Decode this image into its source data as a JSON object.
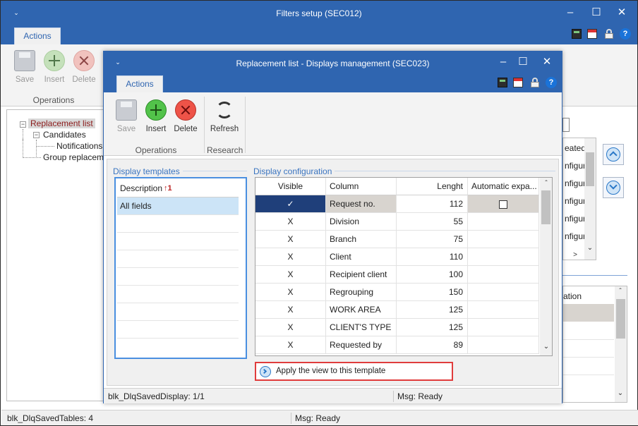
{
  "outer": {
    "title": "Filters setup (SEC012)",
    "tab": "Actions",
    "buttons": {
      "save": "Save",
      "insert": "Insert",
      "delete": "Delete"
    },
    "group_operations": "Operations",
    "tree": {
      "root": "Replacement list",
      "child1": "Candidates",
      "grandchild1": "Notifications",
      "child2": "Group replacemen"
    },
    "right_list": [
      "eated",
      "nfigur",
      "nfigur",
      "nfigur",
      "nfigur",
      "nfigur"
    ],
    "right_list2_header": "ation",
    "scroll_right_arrow": ">",
    "status": {
      "left": "blk_DlqSavedTables: 4",
      "right": "Msg: Ready"
    }
  },
  "inner": {
    "title": "Replacement list - Displays management (SEC023)",
    "tab": "Actions",
    "buttons": {
      "save": "Save",
      "insert": "Insert",
      "delete": "Delete",
      "refresh": "Refresh"
    },
    "group_operations": "Operations",
    "group_research": "Research",
    "templates": {
      "legend": "Display templates",
      "header": "Description",
      "sort_indicator": "↑1",
      "rows": [
        "All fields"
      ]
    },
    "config": {
      "legend": "Display configuration",
      "headers": {
        "visible": "Visible",
        "column": "Column",
        "length": "Lenght",
        "auto": "Automatic expa..."
      },
      "rows": [
        {
          "visible": "✓",
          "column": "Request no.",
          "length": "112"
        },
        {
          "visible": "X",
          "column": "Division",
          "length": "55"
        },
        {
          "visible": "X",
          "column": "Branch",
          "length": "75"
        },
        {
          "visible": "X",
          "column": "Client",
          "length": "110"
        },
        {
          "visible": "X",
          "column": "Recipient client",
          "length": "100"
        },
        {
          "visible": "X",
          "column": "Regrouping",
          "length": "150"
        },
        {
          "visible": "X",
          "column": "WORK AREA",
          "length": "125"
        },
        {
          "visible": "X",
          "column": "CLIENT'S TYPE",
          "length": "125"
        },
        {
          "visible": "X",
          "column": "Requested by",
          "length": "89"
        }
      ]
    },
    "apply_label": "Apply the view to this template",
    "status": {
      "left": "blk_DlqSavedDisplay: 1/1",
      "right": "Msg: Ready"
    }
  },
  "colors": {
    "title_bar": "#2f65b0",
    "selected_row": "#cce4f7",
    "dark_selected": "#1f3f7a",
    "highlight_border": "#e03c3c"
  }
}
